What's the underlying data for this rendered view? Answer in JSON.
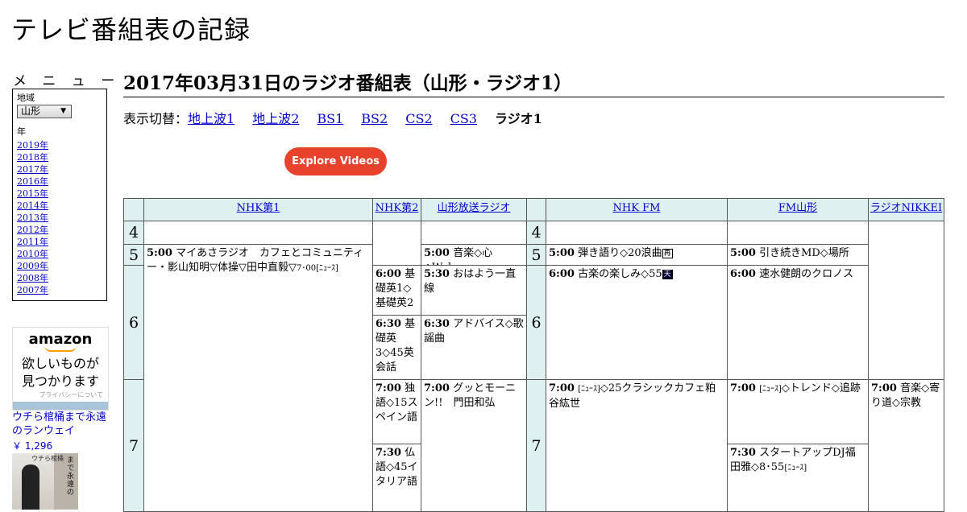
{
  "site": {
    "title": "テレビ番組表の記録"
  },
  "sidebar": {
    "menu_heading": "メ ニ ュ ー",
    "region_label": "地域",
    "region_value": "山形",
    "year_label": "年",
    "years": [
      "2019年",
      "2018年",
      "2017年",
      "2016年",
      "2015年",
      "2014年",
      "2013年",
      "2012年",
      "2011年",
      "2010年",
      "2009年",
      "2008年",
      "2007年"
    ]
  },
  "ad": {
    "brand": "amazon",
    "copy_line1": "欲しいものが",
    "copy_line2": "見つかります",
    "privacy": "プライバシーについて",
    "product_title": "ウチら棺桶まで永遠のランウェイ",
    "product_price": "￥ 1,296",
    "thumb_caption": "ウチら棺桶",
    "thumb_vertical": "まで永遠の"
  },
  "main": {
    "page_title": "2017年03月31日のラジオ番組表（山形・ラジオ1）",
    "switch_label": "表示切替：",
    "switch_links": [
      "地上波1",
      "地上波2",
      "BS1",
      "BS2",
      "CS2",
      "CS3"
    ],
    "switch_current": "ラジオ1",
    "explore_button": "Explore Videos"
  },
  "schedule": {
    "channels": [
      "NHK第1",
      "NHK第2",
      "山形放送ラジオ",
      "NHK FM",
      "FM山形",
      "ラジオNIKKEI"
    ],
    "hours": [
      "4",
      "5",
      "6",
      "7"
    ],
    "programs": {
      "nhk1_0500": {
        "time": "5:00",
        "title": "マイあさラジオ　カフェとコミュニティー・影山知明▽体操▽田中直毅▽",
        "tail": "7･00",
        "news": "[ﾆｭｰｽ]"
      },
      "nhk2_0600": {
        "time": "6:00",
        "title": "基礎英1◇基礎英2"
      },
      "nhk2_0630": {
        "time": "6:30",
        "title": "基礎英3◇45英会話"
      },
      "nhk2_0700": {
        "time": "7:00",
        "title": "独語◇15スペイン語"
      },
      "nhk2_0730": {
        "time": "7:30",
        "title": "仏語◇45イタリア語"
      },
      "ybc_0500": {
        "time": "5:00",
        "title": "音楽◇心◇Wake"
      },
      "ybc_0530": {
        "time": "5:30",
        "title": "おはよう一直線"
      },
      "ybc_0630": {
        "time": "6:30",
        "title": "アドバイス◇歌謡曲"
      },
      "ybc_0700": {
        "time": "7:00",
        "title": "グッとモーニン!!　門田和弘"
      },
      "fm_0500": {
        "time": "5:00",
        "title": "弾き語り◇20浪曲",
        "badge": "再"
      },
      "fm_0600": {
        "time": "6:00",
        "title": "古楽の楽しみ◇55",
        "badge": "天"
      },
      "fm_0700": {
        "time": "7:00",
        "news": "[ﾆｭｰｽ]",
        "title": "◇25クラシックカフェ粕谷紘世"
      },
      "fmy_0500": {
        "time": "5:00",
        "title": "引き続きMD◇場所"
      },
      "fmy_0600": {
        "time": "6:00",
        "title": "速水健朗のクロノス"
      },
      "fmy_0700": {
        "time": "7:00",
        "news": "[ﾆｭｰｽ]",
        "title": "◇トレンド◇追跡"
      },
      "fmy_0730": {
        "time": "7:30",
        "title": "スタートアップDJ福田雅◇8･55",
        "news": "[ﾆｭｰｽ]"
      },
      "nikkei_0700": {
        "time": "7:00",
        "title": "音楽◇寄り道◇宗教"
      }
    }
  }
}
